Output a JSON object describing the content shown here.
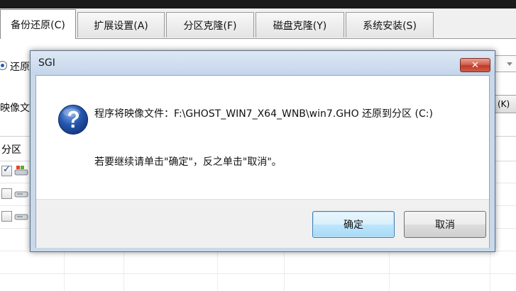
{
  "tabs": [
    {
      "label": "备份还原(C)",
      "active": true
    },
    {
      "label": "扩展设置(A)",
      "active": false
    },
    {
      "label": "分区克隆(F)",
      "active": false
    },
    {
      "label": "磁盘克隆(Y)",
      "active": false
    },
    {
      "label": "系统安装(S)",
      "active": false
    }
  ],
  "background": {
    "restore_radio_label": "还原",
    "image_file_label": "映像文",
    "side_button_label": "(K)",
    "table_header_partition": "分区"
  },
  "dialog": {
    "title": "SGI",
    "close_glyph": "✕",
    "message_line1": "程序将映像文件：F:\\GHOST_WIN7_X64_WNB\\win7.GHO 还原到分区 (C:)",
    "message_line2": "若要继续请单击\"确定\"，反之单击\"取消\"。",
    "ok_label": "确定",
    "cancel_label": "取消"
  },
  "colors": {
    "dialog_frame": "#c9d8ea",
    "close_button": "#c0392b",
    "question_icon": "#1e4fa8"
  },
  "icons": [
    "question-icon",
    "close-icon",
    "disk-icon",
    "windows-disk-icon",
    "dropdown-arrow-icon"
  ]
}
